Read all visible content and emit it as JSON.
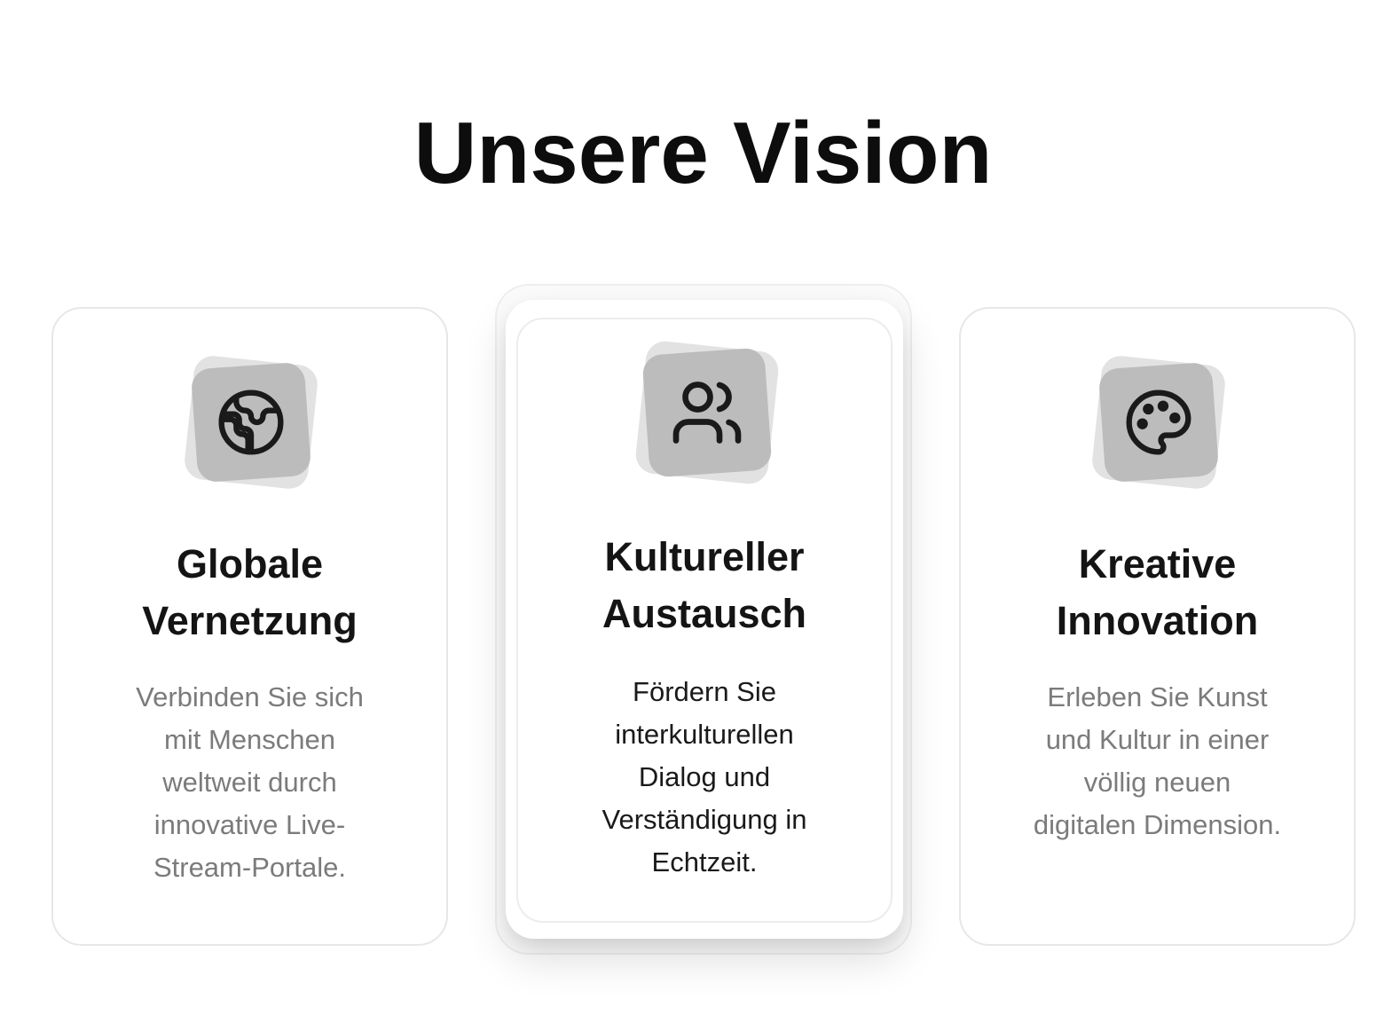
{
  "section": {
    "title": "Unsere Vision"
  },
  "cards": [
    {
      "icon": "globe-icon",
      "title_line1": "Globale",
      "title_line2": "Vernetzung",
      "text_lines": [
        "Verbinden Sie sich",
        "mit Menschen",
        "weltweit durch",
        "innovative Live-",
        "Stream-Portale."
      ]
    },
    {
      "icon": "users-icon",
      "title_line1": "Kultureller",
      "title_line2": "Austausch",
      "text_lines": [
        "Fördern Sie",
        "interkulturellen",
        "Dialog und",
        "Verständigung in",
        "Echtzeit."
      ]
    },
    {
      "icon": "palette-icon",
      "title_line1": "Kreative",
      "title_line2": "Innovation",
      "text_lines": [
        "Erleben Sie Kunst",
        "und Kultur in einer",
        "völlig neuen",
        "digitalen Dimension."
      ]
    }
  ],
  "colors": {
    "icon_tile": "#bcbcbc",
    "muted_text": "#7b7b7b",
    "heading": "#0d0d0d"
  }
}
